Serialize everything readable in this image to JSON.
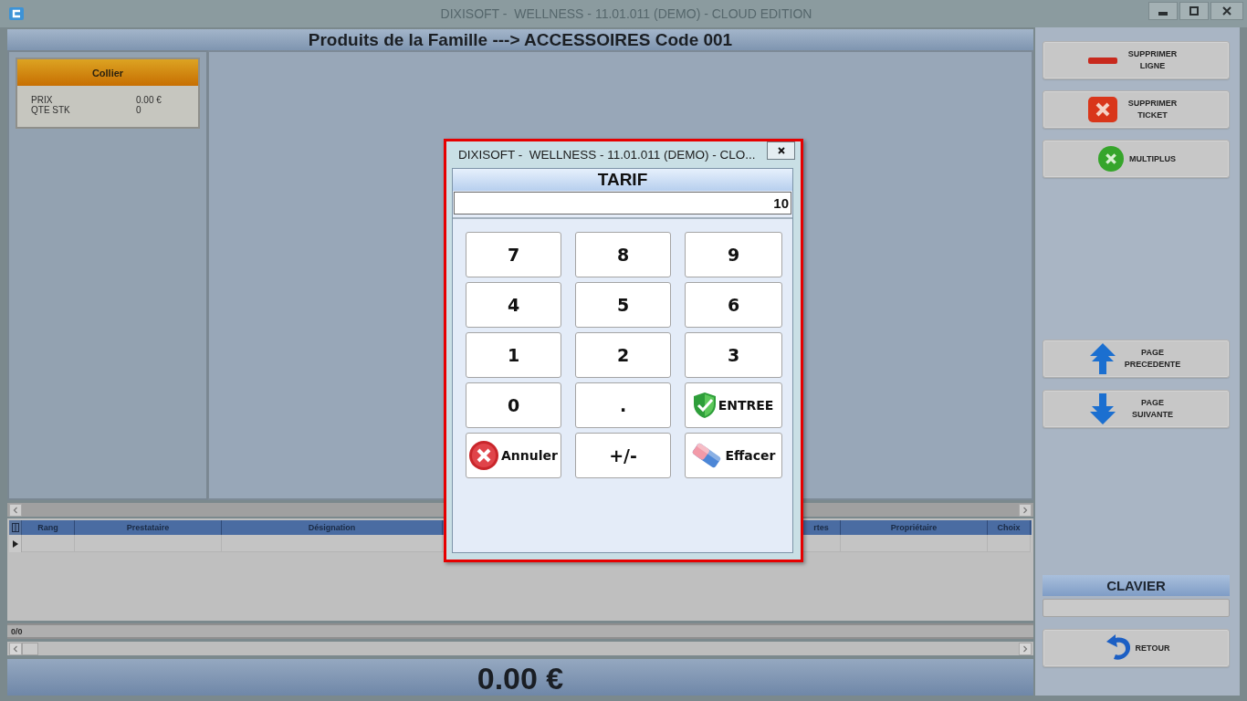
{
  "window": {
    "title": "DIXISOFT -  WELLNESS - 11.01.011 (DEMO) - CLOUD EDITION"
  },
  "family_header": {
    "title": "Produits de la Famille ---> ACCESSOIRES Code 001"
  },
  "products": [
    {
      "name": "Collier",
      "price_label": "PRIX",
      "price": "0.00 €",
      "stock_label": "QTE STK",
      "stock": "0"
    }
  ],
  "ticket_table": {
    "columns": [
      "Rang",
      "Prestataire",
      "Désignation",
      "rtes",
      "Propriétaire",
      "Choix"
    ]
  },
  "record_counter": "0/0",
  "total": "0.00 €",
  "side_panel": {
    "actions": [
      {
        "kind": "delete-line",
        "label": "SUPPRIMER LIGNE"
      },
      {
        "kind": "delete-ticket",
        "label": "SUPPRIMER TICKET"
      },
      {
        "kind": "multi",
        "label": "MULTIPLUS"
      }
    ],
    "paging": [
      {
        "kind": "previous",
        "label": "PAGE PRECEDENTE"
      },
      {
        "kind": "next",
        "label": "PAGE SUIVANTE"
      }
    ],
    "keyboard": {
      "title": "CLAVIER"
    },
    "back_button": {
      "label": "RETOUR"
    }
  },
  "dialog": {
    "title": "DIXISOFT -  WELLNESS - 11.01.011 (DEMO) - CLO...",
    "field": {
      "label": "TARIF",
      "value": "10"
    },
    "keys": [
      {
        "kind": "plain",
        "label": "7"
      },
      {
        "kind": "plain",
        "label": "8"
      },
      {
        "kind": "plain",
        "label": "9"
      },
      {
        "kind": "plain",
        "label": "4"
      },
      {
        "kind": "plain",
        "label": "5"
      },
      {
        "kind": "plain",
        "label": "6"
      },
      {
        "kind": "plain",
        "label": "1"
      },
      {
        "kind": "plain",
        "label": "2"
      },
      {
        "kind": "plain",
        "label": "3"
      },
      {
        "kind": "plain",
        "label": "0"
      },
      {
        "kind": "plain",
        "label": "."
      },
      {
        "kind": "enter",
        "label": "ENTREE"
      },
      {
        "kind": "cancel",
        "label": "Annuler"
      },
      {
        "kind": "plain",
        "label": "+/-"
      },
      {
        "kind": "erase",
        "label": "Effacer"
      }
    ]
  }
}
